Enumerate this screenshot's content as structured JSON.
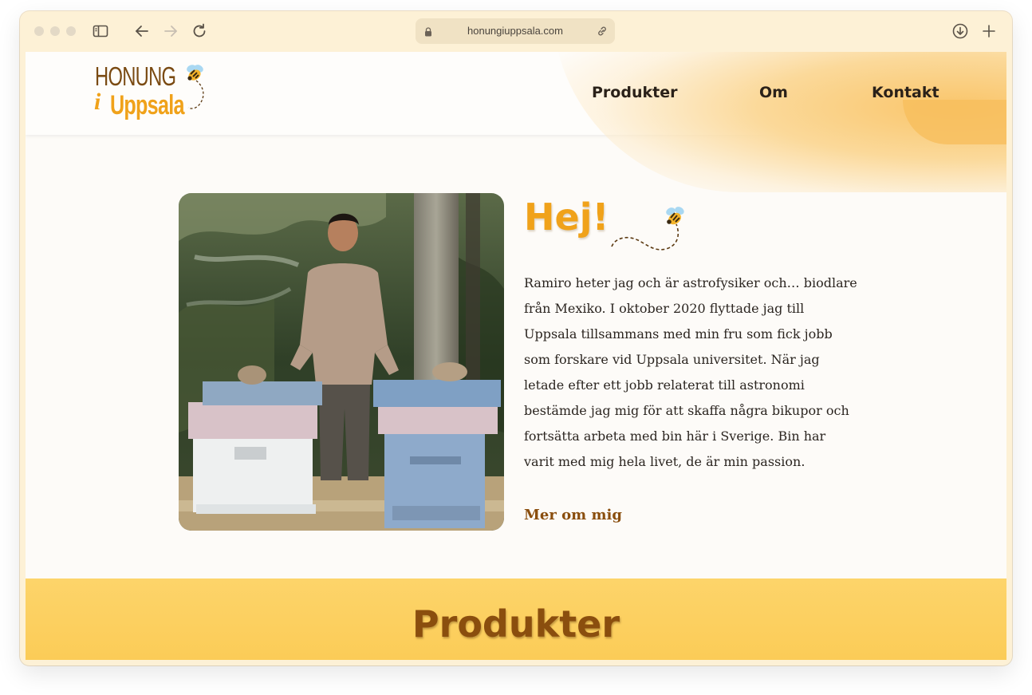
{
  "browser": {
    "url": "honungiuppsala.com",
    "icons": [
      "sidebar-icon",
      "back-icon",
      "forward-icon",
      "reload-icon",
      "lock-icon",
      "link-icon",
      "download-icon",
      "new-tab-icon"
    ]
  },
  "site": {
    "logo": {
      "line1": "HONUNG",
      "line2_prefix": "i",
      "line2": "Uppsala"
    },
    "nav": [
      {
        "label": "Produkter"
      },
      {
        "label": "Om"
      },
      {
        "label": "Kontakt"
      }
    ]
  },
  "intro": {
    "heading": "Hej!",
    "body": "Ramiro heter jag och är astrofysiker och… biodlare från Mexiko. I oktober 2020 flyttade jag till Uppsala tillsammans med min fru som fick jobb som forskare vid Uppsala universitet. När jag letade efter ett jobb relaterat till astronomi bestämde jag mig för att skaffa några bikupor och fortsätta arbeta med bin här i Sverige. Bin har varit med mig hela livet, de är min passion.",
    "more_link": "Mer om mig"
  },
  "products_section": {
    "title": "Produkter"
  },
  "colors": {
    "accent": "#f0a21a",
    "brown": "#8a4e0e",
    "band": "#fcd262",
    "chrome": "#fdf1d6"
  }
}
